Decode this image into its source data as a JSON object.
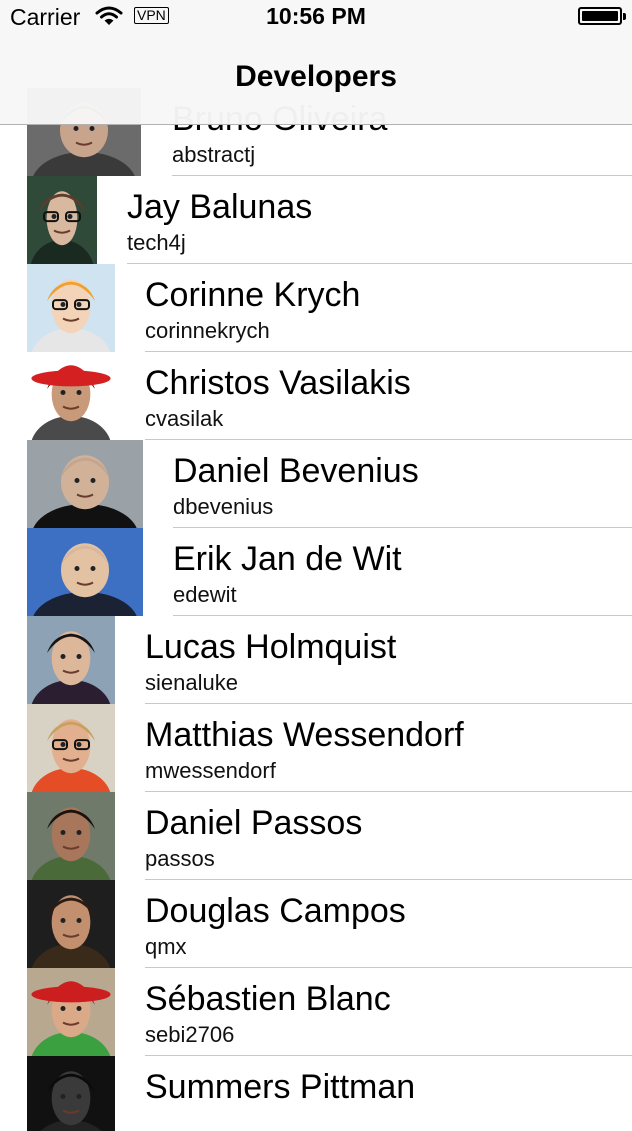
{
  "status_bar": {
    "carrier": "Carrier",
    "vpn": "VPN",
    "time": "10:56 PM",
    "battery_level": 1.0
  },
  "navbar": {
    "title": "Developers"
  },
  "developers": [
    {
      "name": "Bruno Oliveira",
      "username": "abstractj",
      "avatar": "photo-of-bruno"
    },
    {
      "name": "Jay Balunas",
      "username": "tech4j",
      "avatar": "photo-of-jay"
    },
    {
      "name": "Corinne Krych",
      "username": "corinnekrych",
      "avatar": "cartoon-of-corinne"
    },
    {
      "name": "Christos Vasilakis",
      "username": "cvasilak",
      "avatar": "photo-of-christos"
    },
    {
      "name": "Daniel Bevenius",
      "username": "dbevenius",
      "avatar": "photo-of-daniel"
    },
    {
      "name": "Erik Jan de Wit",
      "username": "edewit",
      "avatar": "photo-of-erik"
    },
    {
      "name": "Lucas Holmquist",
      "username": "sienaluke",
      "avatar": "photo-of-lucas"
    },
    {
      "name": "Matthias Wessendorf",
      "username": "mwessendorf",
      "avatar": "photo-of-matthias"
    },
    {
      "name": "Daniel Passos",
      "username": "passos",
      "avatar": "photo-of-daniel-passos"
    },
    {
      "name": "Douglas Campos",
      "username": "qmx",
      "avatar": "photo-of-douglas"
    },
    {
      "name": "Sébastien Blanc",
      "username": "sebi2706",
      "avatar": "photo-of-sebastien"
    },
    {
      "name": "Summers Pittman",
      "username": "",
      "avatar": "photo-of-summers"
    }
  ],
  "colors": {
    "separator": "#c8c7cc",
    "navbar_bg": "#f7f7f7"
  }
}
